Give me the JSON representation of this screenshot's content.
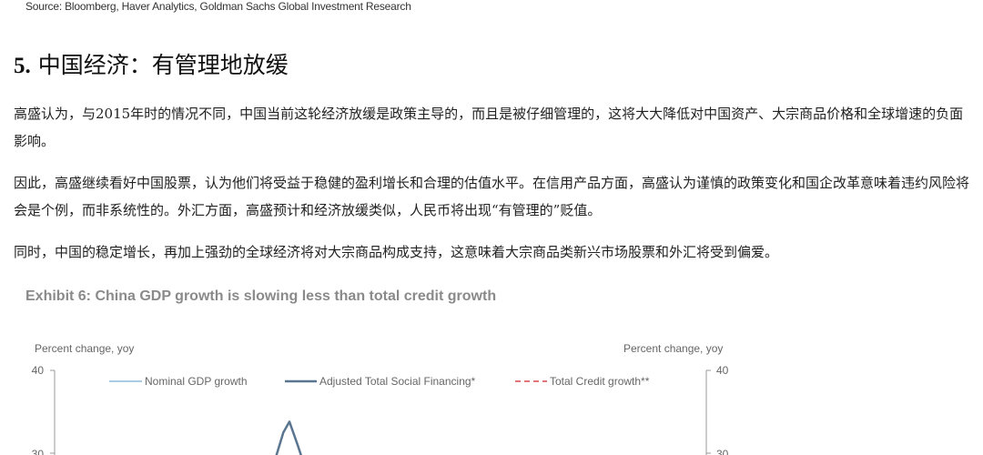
{
  "source_note": "Source: Bloomberg, Haver Analytics, Goldman Sachs Global Investment Research",
  "section": {
    "number": "5.",
    "title": "中国经济：有管理地放缓"
  },
  "paragraphs": [
    "高盛认为，与2015年时的情况不同，中国当前这轮经济放缓是政策主导的，而且是被仔细管理的，这将大大降低对中国资产、大宗商品价格和全球增速的负面影响。",
    "因此，高盛继续看好中国股票，认为他们将受益于稳健的盈利增长和合理的估值水平。在信用产品方面，高盛认为谨慎的政策变化和国企改革意味着违约风险将会是个例，而非系统性的。外汇方面，高盛预计和经济放缓类似，人民币将出现“有管理的”贬值。",
    "同时，中国的稳定增长，再加上强劲的全球经济将对大宗商品构成支持，这意味着大宗商品类新兴市场股票和外汇将受到偏爱。"
  ],
  "chart_data": {
    "type": "line",
    "title": "Exhibit 6: China GDP growth is slowing less than total credit growth",
    "ylabel_left": "Percent change, yoy",
    "ylabel_right": "Percent change, yoy",
    "y_ticks_left": [
      "40",
      "30"
    ],
    "y_ticks_right": [
      "40",
      "30"
    ],
    "ylim": [
      0,
      40
    ],
    "legend_position": "top",
    "series": [
      {
        "name": "Nominal GDP growth",
        "color": "#a9cbe3",
        "style": "solid"
      },
      {
        "name": "Adjusted Total Social Financing*",
        "color": "#5a7590",
        "style": "solid",
        "visible_points": [
          [
            0.0,
            29.5
          ],
          [
            0.55,
            32.5
          ],
          [
            1.0,
            33.8
          ],
          [
            1.6,
            31.0
          ],
          [
            2.0,
            29.0
          ]
        ]
      },
      {
        "name": "Total Credit growth**",
        "color": "#e0757a",
        "style": "dashed"
      }
    ]
  }
}
